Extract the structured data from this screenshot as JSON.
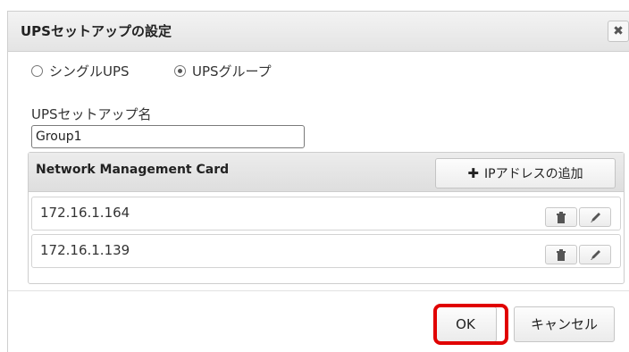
{
  "dialog": {
    "title": "UPSセットアップの設定",
    "close_label": "✖"
  },
  "mode": {
    "options": [
      {
        "label": "シングルUPS",
        "selected": false
      },
      {
        "label": "UPSグループ",
        "selected": true
      }
    ]
  },
  "setup_name": {
    "label": "UPSセットアップ名",
    "value": "Group1"
  },
  "nmc": {
    "header": "Network Management Card",
    "add_button_label": "IPアドレスの追加",
    "add_button_icon": "plus-icon",
    "rows": [
      {
        "ip": "172.16.1.164",
        "delete_icon": "trash-icon",
        "edit_icon": "pencil-icon"
      },
      {
        "ip": "172.16.1.139",
        "delete_icon": "trash-icon",
        "edit_icon": "pencil-icon"
      }
    ]
  },
  "footer": {
    "ok_label": "OK",
    "cancel_label": "キャンセル",
    "highlight_color": "#e00000"
  }
}
